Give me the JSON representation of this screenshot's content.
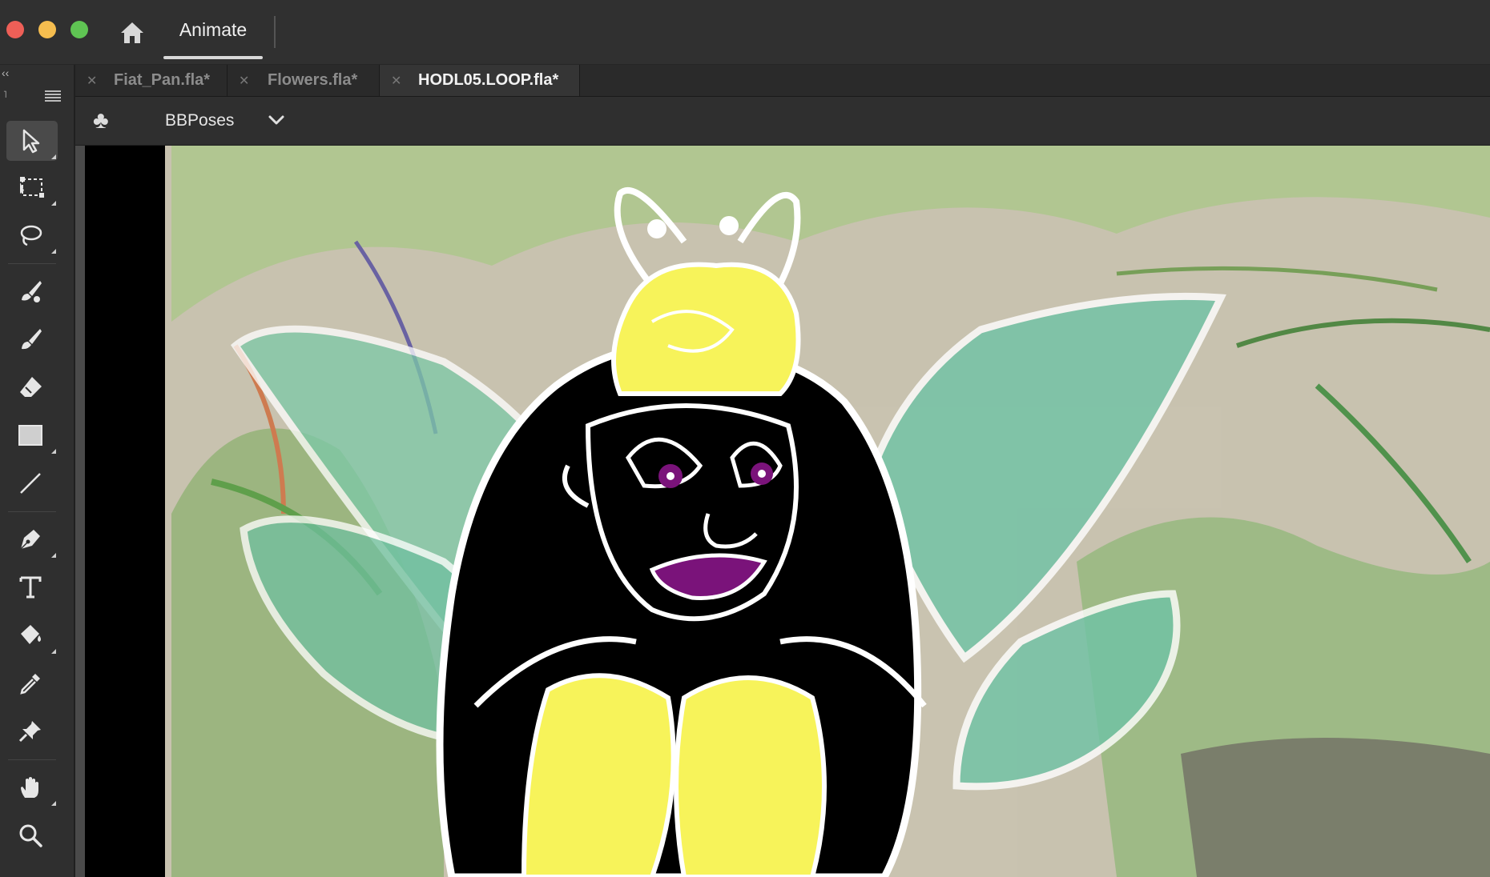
{
  "titlebar": {
    "app_tab_label": "Animate"
  },
  "document_tabs": [
    {
      "label": "Fiat_Pan.fla*",
      "active": false
    },
    {
      "label": "Flowers.fla*",
      "active": false
    },
    {
      "label": "HODL05.LOOP.fla*",
      "active": true
    }
  ],
  "edit_bar": {
    "scene_name": "BBPoses"
  },
  "tools": [
    {
      "name": "selection-tool",
      "icon": "arrow-icon",
      "active": true
    },
    {
      "name": "free-transform-tool",
      "icon": "transform-icon"
    },
    {
      "name": "lasso-tool",
      "icon": "lasso-icon"
    },
    {
      "name": "paint-brush-tool",
      "icon": "paint-brush-icon"
    },
    {
      "name": "brush-tool",
      "icon": "brush-icon"
    },
    {
      "name": "eraser-tool",
      "icon": "eraser-icon"
    },
    {
      "name": "rectangle-tool",
      "icon": "rectangle-icon"
    },
    {
      "name": "line-tool",
      "icon": "line-icon"
    },
    {
      "name": "pen-tool",
      "icon": "pen-icon"
    },
    {
      "name": "text-tool",
      "icon": "text-icon"
    },
    {
      "name": "paint-bucket-tool",
      "icon": "paint-bucket-icon"
    },
    {
      "name": "eyedropper-tool",
      "icon": "eyedropper-icon"
    },
    {
      "name": "pin-tool",
      "icon": "pin-icon"
    },
    {
      "name": "hand-tool",
      "icon": "hand-icon"
    },
    {
      "name": "zoom-tool",
      "icon": "magnifier-icon"
    }
  ],
  "colors": {
    "chrome": "#303030",
    "panel": "#2f2f2f",
    "traffic_red": "#ee5f57",
    "traffic_yellow": "#f5bd4f",
    "traffic_green": "#5fc453",
    "fairy_yellow": "#f7f35a",
    "fairy_purple": "#7a137a",
    "wing_teal": "#6fc3a6"
  }
}
